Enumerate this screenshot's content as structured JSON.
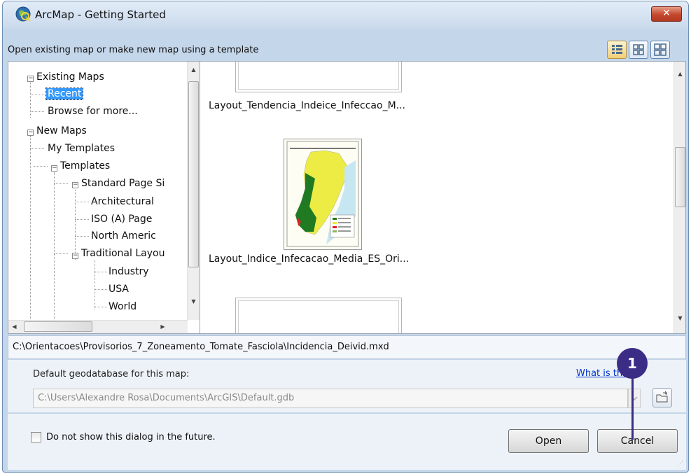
{
  "window": {
    "title": "ArcMap - Getting Started",
    "close_glyph": "✕"
  },
  "header": {
    "subtitle": "Open existing map or make new map using a template"
  },
  "tree": {
    "existing_maps": "Existing Maps",
    "recent": "Recent",
    "browse": "Browse for more...",
    "new_maps": "New Maps",
    "my_templates": "My Templates",
    "templates": "Templates",
    "standard_page": "Standard Page Si",
    "architectural": "Architectural",
    "iso": "ISO (A) Page",
    "north_american": "North Americ",
    "traditional": "Traditional Layou",
    "industry": "Industry",
    "usa": "USA",
    "world": "World"
  },
  "gallery": {
    "items": [
      {
        "label": "Layout_Tendencia_Indeice_Infeccao_M..."
      },
      {
        "label": "Layout_Indice_Infecacao_Media_ES_Ori..."
      }
    ]
  },
  "path": {
    "text": "C:\\Orientacoes\\Provisorios_7_Zoneamento_Tomate_Fasciola\\Incidencia_Deivid.mxd"
  },
  "gdb": {
    "label": "Default geodatabase for this map:",
    "link": "What is this",
    "value": "C:\\Users\\Alexandre Rosa\\Documents\\ArcGIS\\Default.gdb"
  },
  "footer": {
    "checkbox_label": "Do not show this dialog in the future.",
    "open_label": "Open",
    "cancel_label": "Cancel"
  },
  "callout": {
    "number": "1"
  },
  "colors": {
    "accent": "#3b2d86",
    "selection": "#3399ff",
    "link": "#0033cc"
  }
}
